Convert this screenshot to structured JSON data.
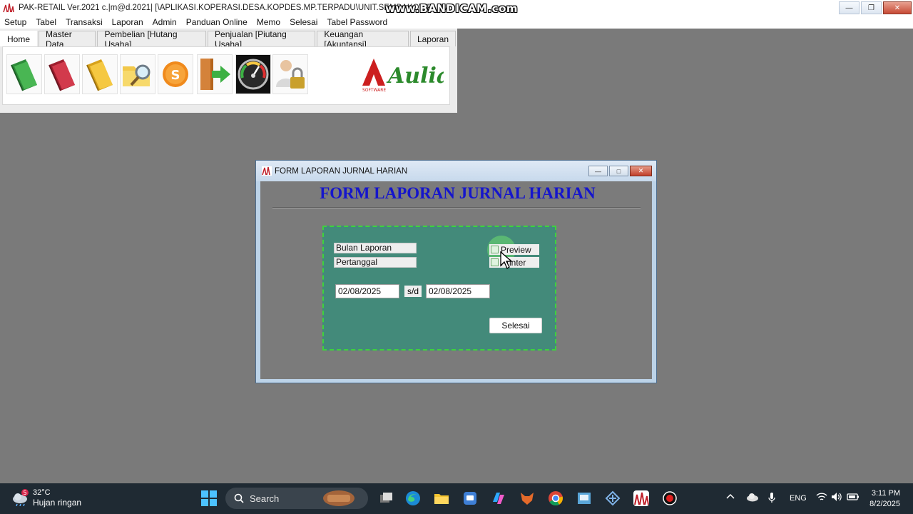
{
  "app": {
    "title": "PAK-RETAIL Ver.2021 c.|m@d.2021| [\\APLIKASI.KOPERASI.DESA.KOPDES.MP.TERPADU\\UNIT.SEMBAKO\\APLIDATA\\...",
    "watermark": "www.BANDICAM.com"
  },
  "menu": [
    "Setup",
    "Tabel",
    "Transaksi",
    "Laporan",
    "Admin",
    "Panduan Online",
    "Memo",
    "Selesai",
    "Tabel Password"
  ],
  "ribbon": {
    "tabs": [
      "Home",
      "Master Data",
      "Pembelian [Hutang Usaha]",
      "Penjualan [Piutang Usaha]",
      "Keuangan [Akuntansi]",
      "Laporan"
    ],
    "active_tab": "Home",
    "logo_text": "Aulia",
    "logo_subtext": "SOFTWARE"
  },
  "dialog": {
    "title": "FORM LAPORAN JURNAL HARIAN",
    "heading": "FORM LAPORAN JURNAL HARIAN",
    "label_bulan": "Bulan Laporan",
    "label_pertanggal": "Pertanggal",
    "check_preview": "Preview",
    "check_printer": "Printer",
    "date_from": "02/08/2025",
    "sd_label": "s/d",
    "date_to": "02/08/2025",
    "button_selesai": "Selesai"
  },
  "taskbar": {
    "weather_temp": "32°C",
    "weather_desc": "Hujan ringan",
    "weather_badge": "5",
    "search_placeholder": "Search",
    "language": "ENG",
    "time": "3:11 PM",
    "date": "8/2/2025"
  },
  "colors": {
    "heading_blue": "#1515cc",
    "panel_teal": "#438a7a",
    "panel_border_green": "#3cd33c",
    "desktop_gray": "#7a7a7a"
  }
}
